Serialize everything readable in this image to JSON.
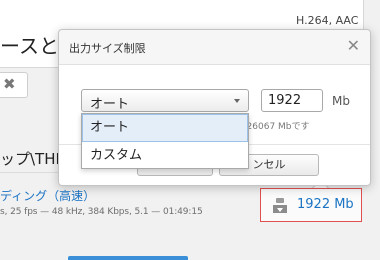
{
  "background": {
    "title_fragment": "ースと同",
    "codec_fragment": "H.264, AAC",
    "remove_chip_icon": "x-icon",
    "path_fragment": "ップ\\THE",
    "encode_link": "ディング（高速）",
    "meta": "s, 25 fps — 48 kHz, 384 Kbps, 5.1 — 01:49:15",
    "size_button": {
      "label": "1922 Mb",
      "icon": "size-icon"
    }
  },
  "dialog": {
    "title": "出力サイズ制限",
    "close_icon": "close-icon",
    "mode_select": {
      "value": "オート",
      "options": [
        "オート",
        "カスタム"
      ]
    },
    "size_value": "1922",
    "unit": "Mb",
    "hint_fragment": "~26067 Mbです",
    "ok_label": "",
    "cancel_label": "ンセル"
  },
  "colors": {
    "link": "#1a73c4",
    "highlight_border": "#e05050",
    "selection": "#e3eef9"
  }
}
